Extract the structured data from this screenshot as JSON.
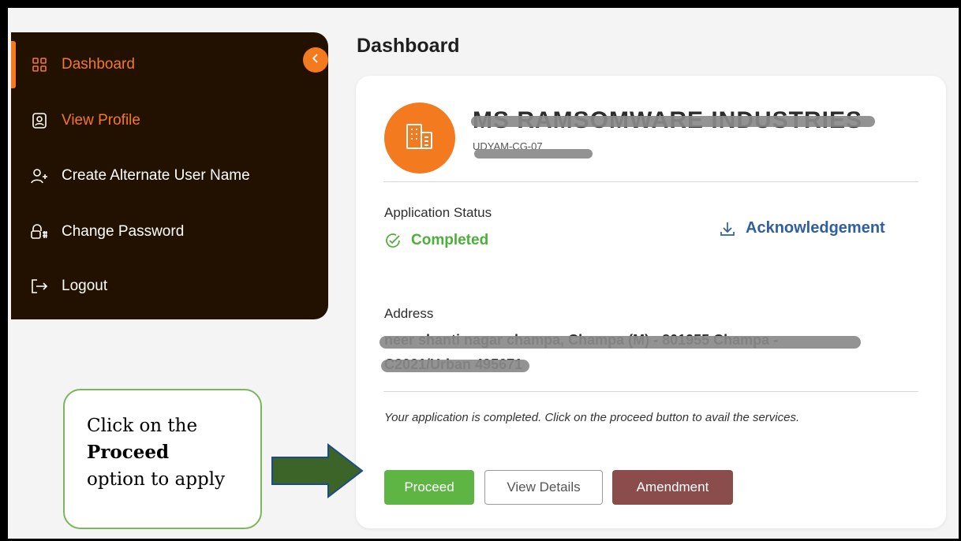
{
  "sidebar": {
    "items": [
      {
        "label": "Dashboard",
        "icon": "grid-icon"
      },
      {
        "label": "View Profile",
        "icon": "profile-icon"
      },
      {
        "label": "Create Alternate User Name",
        "icon": "add-user-icon"
      },
      {
        "label": "Change Password",
        "icon": "password-lock-icon"
      },
      {
        "label": "Logout",
        "icon": "logout-icon"
      }
    ],
    "collapse_icon": "chevron-left-icon"
  },
  "page_title": "Dashboard",
  "card": {
    "company_name": "MS RAMSOMWARE INDUSTRIES",
    "company_id": "UDYAM-CG-07",
    "application_status_label": "Application Status",
    "status_value": "Completed",
    "acknowledgement_label": "Acknowledgement",
    "address_label": "Address",
    "address_line1": "neer shanti nagar champa, Champa (M) - 801955 Champa -",
    "address_line2": "C2021/Urban 495671",
    "note": "Your application is completed. Click on the proceed button to avail the services.",
    "buttons": {
      "proceed": "Proceed",
      "view_details": "View Details",
      "amendment": "Amendment"
    }
  },
  "annotation": {
    "line1": "Click on the",
    "line2": "Proceed",
    "line3": "option to apply"
  },
  "colors": {
    "accent": "#f47a20",
    "sidebar_bg": "#231100",
    "success": "#4caf3a",
    "link": "#2f5fa0",
    "proceed": "#5fb544",
    "amendment": "#8b4d4b",
    "arrow": "#3d6428"
  }
}
